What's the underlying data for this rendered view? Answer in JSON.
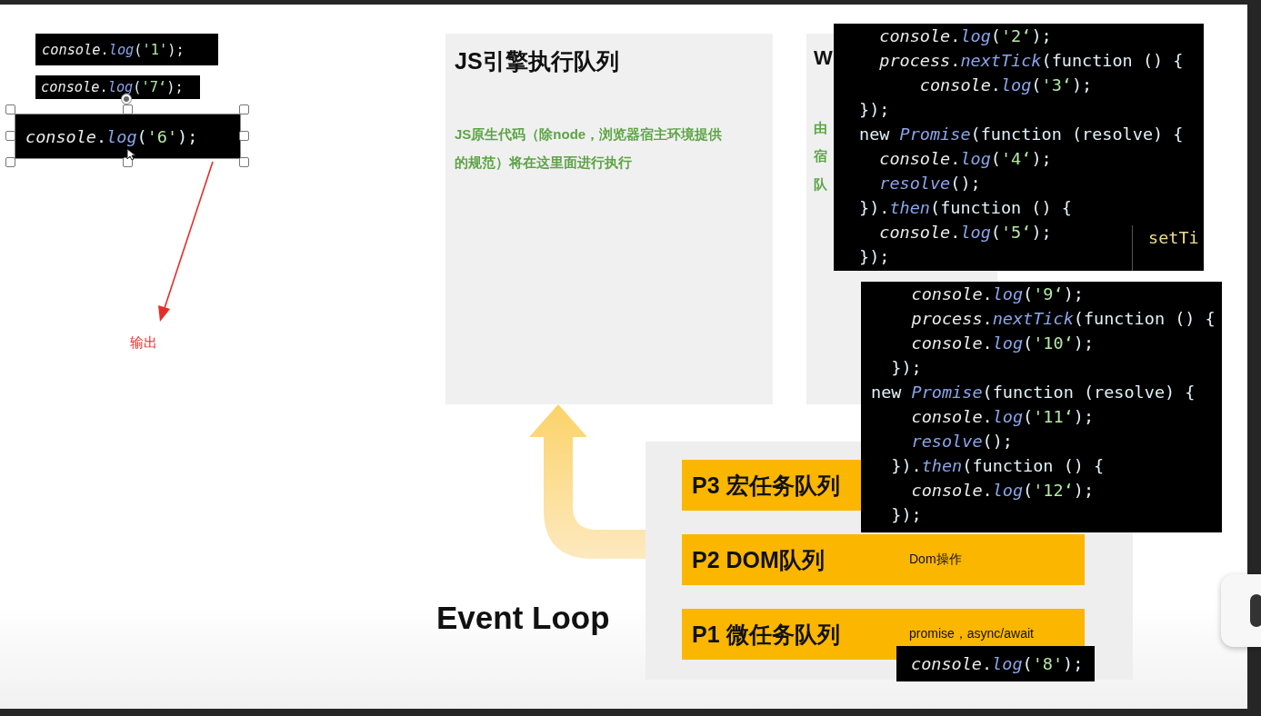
{
  "snippets": [
    {
      "selected": false,
      "code": "console.log('1');"
    },
    {
      "selected": false,
      "code": "console.log('7‘);"
    },
    {
      "selected": true,
      "code": "console.log('6');"
    },
    {
      "selected": false,
      "code": "console.log('8');"
    }
  ],
  "output_label": "输出",
  "panels": [
    {
      "title": "JS引擎执行队列",
      "lines": [
        "JS原生代码（除node，浏览器宿主环境提供",
        "的规范）将在这里面进行执行"
      ]
    },
    {
      "title": "W",
      "lines": [
        "由",
        "宿",
        "队"
      ]
    }
  ],
  "code_blocks": [
    {
      "side_text": "setTi",
      "lines": [
        "  console.log('2‘);",
        "  process.nextTick(function () {",
        "      console.log('3‘);",
        "});",
        "new Promise(function (resolve) {",
        "  console.log('4‘);",
        "  resolve();",
        "}).then(function () {",
        "  console.log('5‘);",
        "});"
      ]
    },
    {
      "lines": [
        "    console.log('9‘);",
        "    process.nextTick(function () {",
        "    console.log('10‘);",
        "  });",
        "new Promise(function (resolve) {",
        "    console.log('11‘);",
        "    resolve();",
        "  }).then(function () {",
        "    console.log('12‘);",
        "  });"
      ]
    }
  ],
  "queues": [
    {
      "label": "P3 宏任务队列"
    },
    {
      "label": "P2 DOM队列",
      "note": "Dom操作"
    },
    {
      "label": "P1 微任务队列",
      "note": "promise，async/await"
    }
  ],
  "heading": "Event Loop"
}
